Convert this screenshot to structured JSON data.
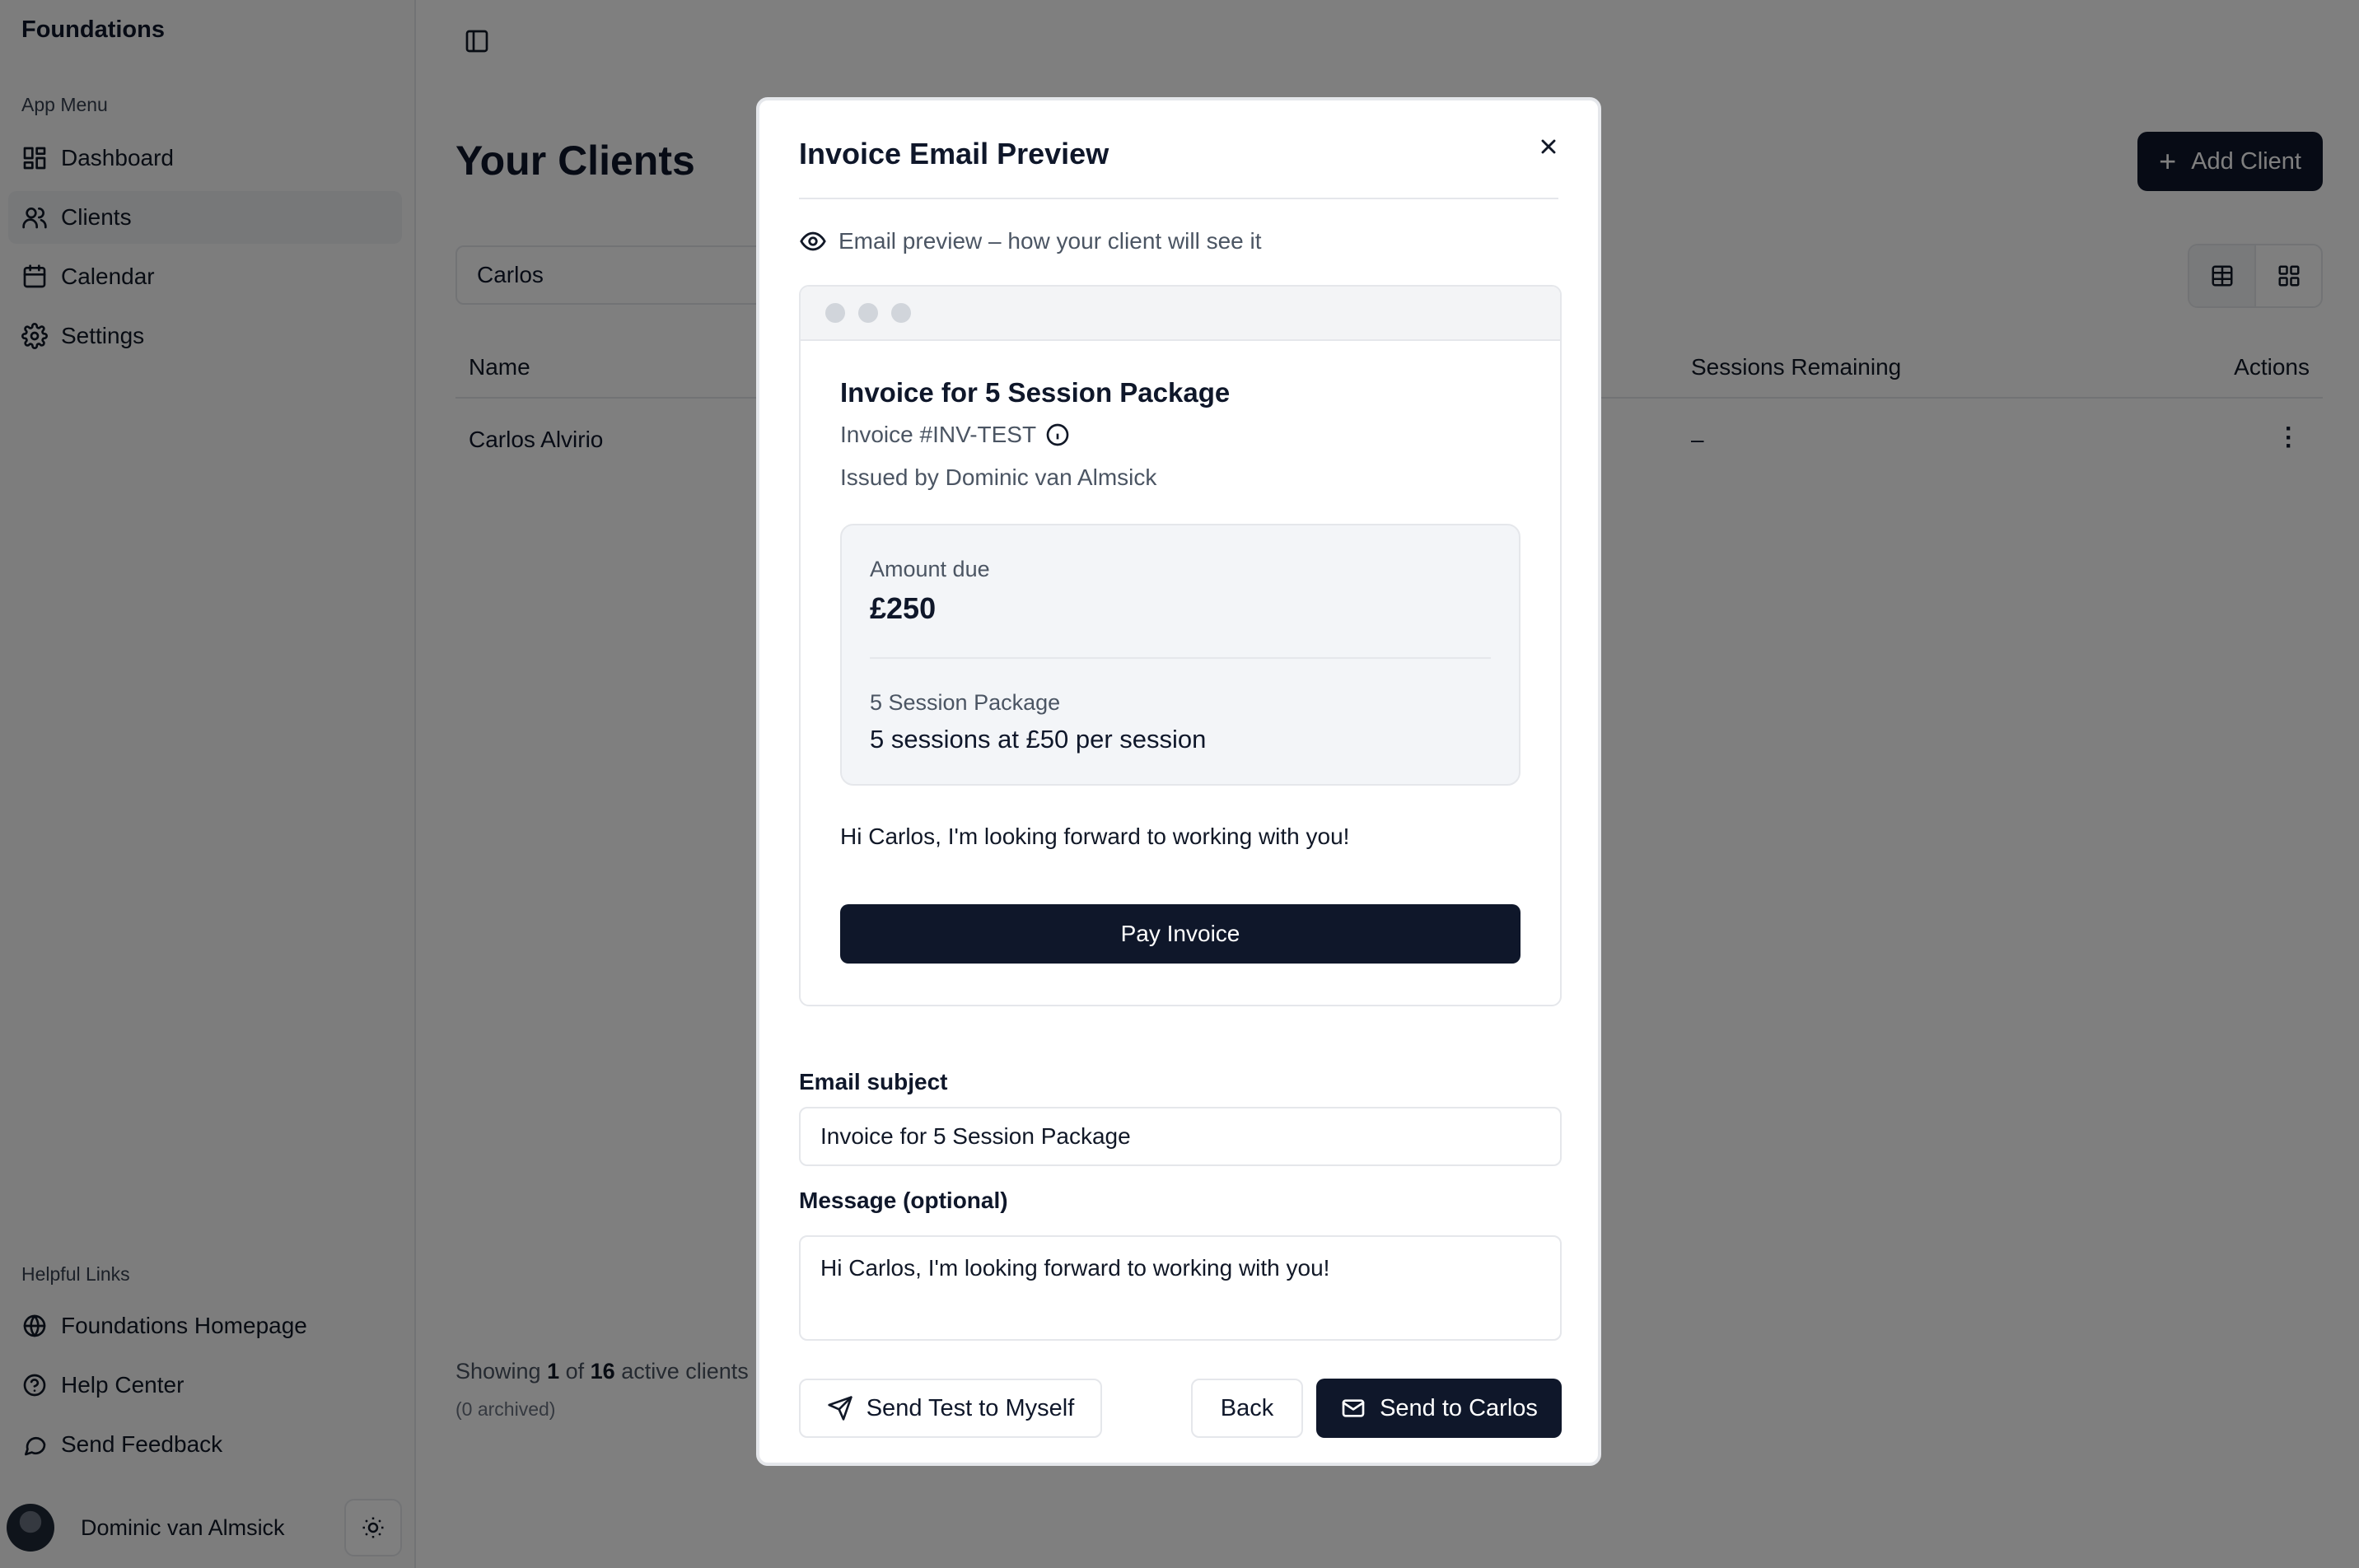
{
  "sidebar": {
    "brand": "Foundations",
    "app_menu_label": "App Menu",
    "items": [
      {
        "label": "Dashboard",
        "icon": "dashboard-icon"
      },
      {
        "label": "Clients",
        "icon": "users-icon",
        "active": true
      },
      {
        "label": "Calendar",
        "icon": "calendar-icon"
      },
      {
        "label": "Settings",
        "icon": "gear-icon"
      }
    ],
    "helpful_links_label": "Helpful Links",
    "links": [
      {
        "label": "Foundations Homepage",
        "icon": "globe-icon"
      },
      {
        "label": "Help Center",
        "icon": "help-circle-icon"
      },
      {
        "label": "Send Feedback",
        "icon": "message-icon"
      }
    ],
    "user_name": "Dominic van Almsick"
  },
  "main": {
    "title": "Your Clients",
    "add_client_label": "Add Client",
    "search_value": "Carlos",
    "columns": {
      "name": "Name",
      "sessions_remaining": "Sessions Remaining",
      "actions": "Actions"
    },
    "rows": [
      {
        "name": "Carlos Alvirio",
        "sessions_remaining": "–"
      }
    ],
    "footer_prefix": "Showing ",
    "footer_shown": "1",
    "footer_of": " of ",
    "footer_total": "16",
    "footer_suffix": " active clients",
    "footer_archived": "(0 archived)"
  },
  "modal": {
    "title": "Invoice Email Preview",
    "preview_note": "Email preview – how your client will see it",
    "email": {
      "invoice_title": "Invoice for 5 Session Package",
      "invoice_number": "Invoice #INV-TEST",
      "issued_by": "Issued by Dominic van Almsick",
      "amount_label": "Amount due",
      "amount_value": "£250",
      "package_label": "5 Session Package",
      "package_detail": "5 sessions at £50 per session",
      "message": "Hi Carlos, I'm looking forward to working with you!",
      "pay_label": "Pay Invoice"
    },
    "subject_label": "Email subject",
    "subject_value": "Invoice for 5 Session Package",
    "message_label": "Message (optional)",
    "message_value": "Hi Carlos, I'm looking forward to working with you!",
    "send_test_label": "Send Test to Myself",
    "back_label": "Back",
    "send_label": "Send to Carlos"
  },
  "colors": {
    "primary": "#0f172a",
    "overlay": "rgba(0,0,0,0.5)",
    "card_bg": "#f3f5f8"
  }
}
